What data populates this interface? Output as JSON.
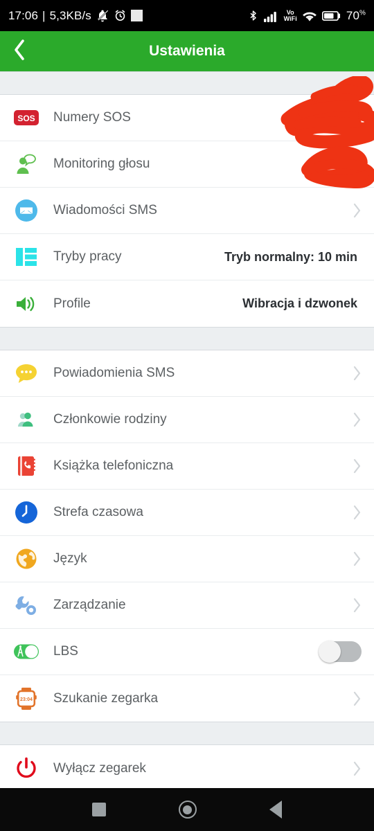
{
  "status_bar": {
    "time": "17:06",
    "separator": "|",
    "data_rate": "5,3KB/s",
    "icons_left": [
      "bell-muted-icon",
      "alarm-clock-icon",
      "white-square-icon"
    ],
    "vowifi_top": "Vo",
    "vowifi_bottom": "WiFi",
    "icons_right": [
      "bluetooth-icon",
      "signal-bars-icon",
      "vowifi-icon",
      "wifi-icon",
      "battery-icon"
    ],
    "battery_percent": "70",
    "battery_percent_symbol": "%"
  },
  "header": {
    "title": "Ustawienia",
    "back_icon": "chevron-left-icon",
    "background_color": "#2BAA2B"
  },
  "groups": [
    {
      "items": [
        {
          "label": "Numery SOS",
          "icon": "sos-badge-icon",
          "value": "",
          "accessory": "redacted",
          "redacted": true
        },
        {
          "label": "Monitoring głosu",
          "icon": "voice-monitor-icon",
          "value": "",
          "accessory": "redacted",
          "redacted": true
        },
        {
          "label": "Wiadomości SMS",
          "icon": "sms-envelope-icon",
          "value": "",
          "accessory": "chevron"
        },
        {
          "label": "Tryby pracy",
          "icon": "work-modes-icon",
          "value": "Tryb normalny: 10 min",
          "accessory": "none"
        },
        {
          "label": "Profile",
          "icon": "speaker-icon",
          "value": "Wibracja i dzwonek",
          "accessory": "none"
        }
      ]
    },
    {
      "items": [
        {
          "label": "Powiadomienia SMS",
          "icon": "chat-bubble-icon",
          "value": "",
          "accessory": "chevron"
        },
        {
          "label": "Członkowie rodziny",
          "icon": "family-member-icon",
          "value": "",
          "accessory": "chevron"
        },
        {
          "label": "Książka telefoniczna",
          "icon": "phonebook-icon",
          "value": "",
          "accessory": "chevron"
        },
        {
          "label": "Strefa czasowa",
          "icon": "clock-icon",
          "value": "",
          "accessory": "chevron"
        },
        {
          "label": "Język",
          "icon": "globe-icon",
          "value": "",
          "accessory": "chevron"
        },
        {
          "label": "Zarządzanie",
          "icon": "wrench-icon",
          "value": "",
          "accessory": "chevron"
        },
        {
          "label": "LBS",
          "icon": "lbs-toggle-icon",
          "value": "",
          "accessory": "toggle",
          "toggle_on": false
        },
        {
          "label": "Szukanie zegarka",
          "icon": "watch-icon",
          "value": "",
          "accessory": "chevron"
        }
      ]
    },
    {
      "items": [
        {
          "label": "Wyłącz zegarek",
          "icon": "power-off-icon",
          "value": "",
          "accessory": "chevron"
        }
      ]
    }
  ],
  "redaction": {
    "color": "#EE3314",
    "note": "handwritten red scribble covering phone numbers"
  },
  "nav_bar": {
    "recents": "square-icon",
    "home": "circle-icon",
    "back": "triangle-left-icon"
  }
}
